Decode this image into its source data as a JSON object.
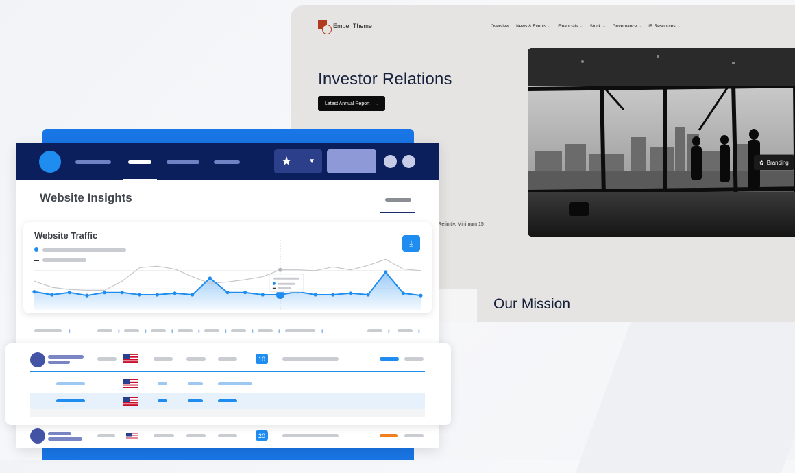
{
  "ir_site": {
    "brand": "Ember Theme",
    "nav": [
      {
        "label": "Overview",
        "has_menu": false
      },
      {
        "label": "News & Events",
        "has_menu": true
      },
      {
        "label": "Financials",
        "has_menu": true
      },
      {
        "label": "Stock",
        "has_menu": true
      },
      {
        "label": "Governance",
        "has_menu": true
      },
      {
        "label": "IR Resources",
        "has_menu": true
      }
    ],
    "hero_title": "Investor Relations",
    "cta_label": "Latest Annual Report",
    "branding_label": "Branding",
    "note_line1": "by Refinitiv. Minimum 15",
    "note_line2": "d.",
    "mission_title": "Our Mission",
    "accent": "#b23a1e"
  },
  "dashboard": {
    "section_title": "Website Insights",
    "card_title": "Website Traffic",
    "accent": "#1f8cf0",
    "nav_dark": "#0b1f5c",
    "rows": [
      {
        "badge": "10",
        "status_color": "#1f8cf0"
      },
      {
        "badge": "20",
        "status_color": "#f07f1f"
      }
    ]
  },
  "chart_data": {
    "type": "line",
    "series": [
      {
        "values": [
          24,
          20,
          23,
          19,
          23,
          23,
          20,
          20,
          22,
          20,
          42,
          23,
          23,
          20,
          20,
          24,
          20,
          20,
          22,
          20,
          50,
          22,
          19
        ]
      },
      {
        "values": [
          38,
          30,
          27,
          26,
          26,
          38,
          56,
          58,
          54,
          44,
          35,
          37,
          40,
          44,
          53,
          53,
          52,
          57,
          53,
          59,
          67,
          54,
          52
        ]
      }
    ],
    "ylim": [
      0,
      80
    ],
    "highlight_index": 14
  }
}
